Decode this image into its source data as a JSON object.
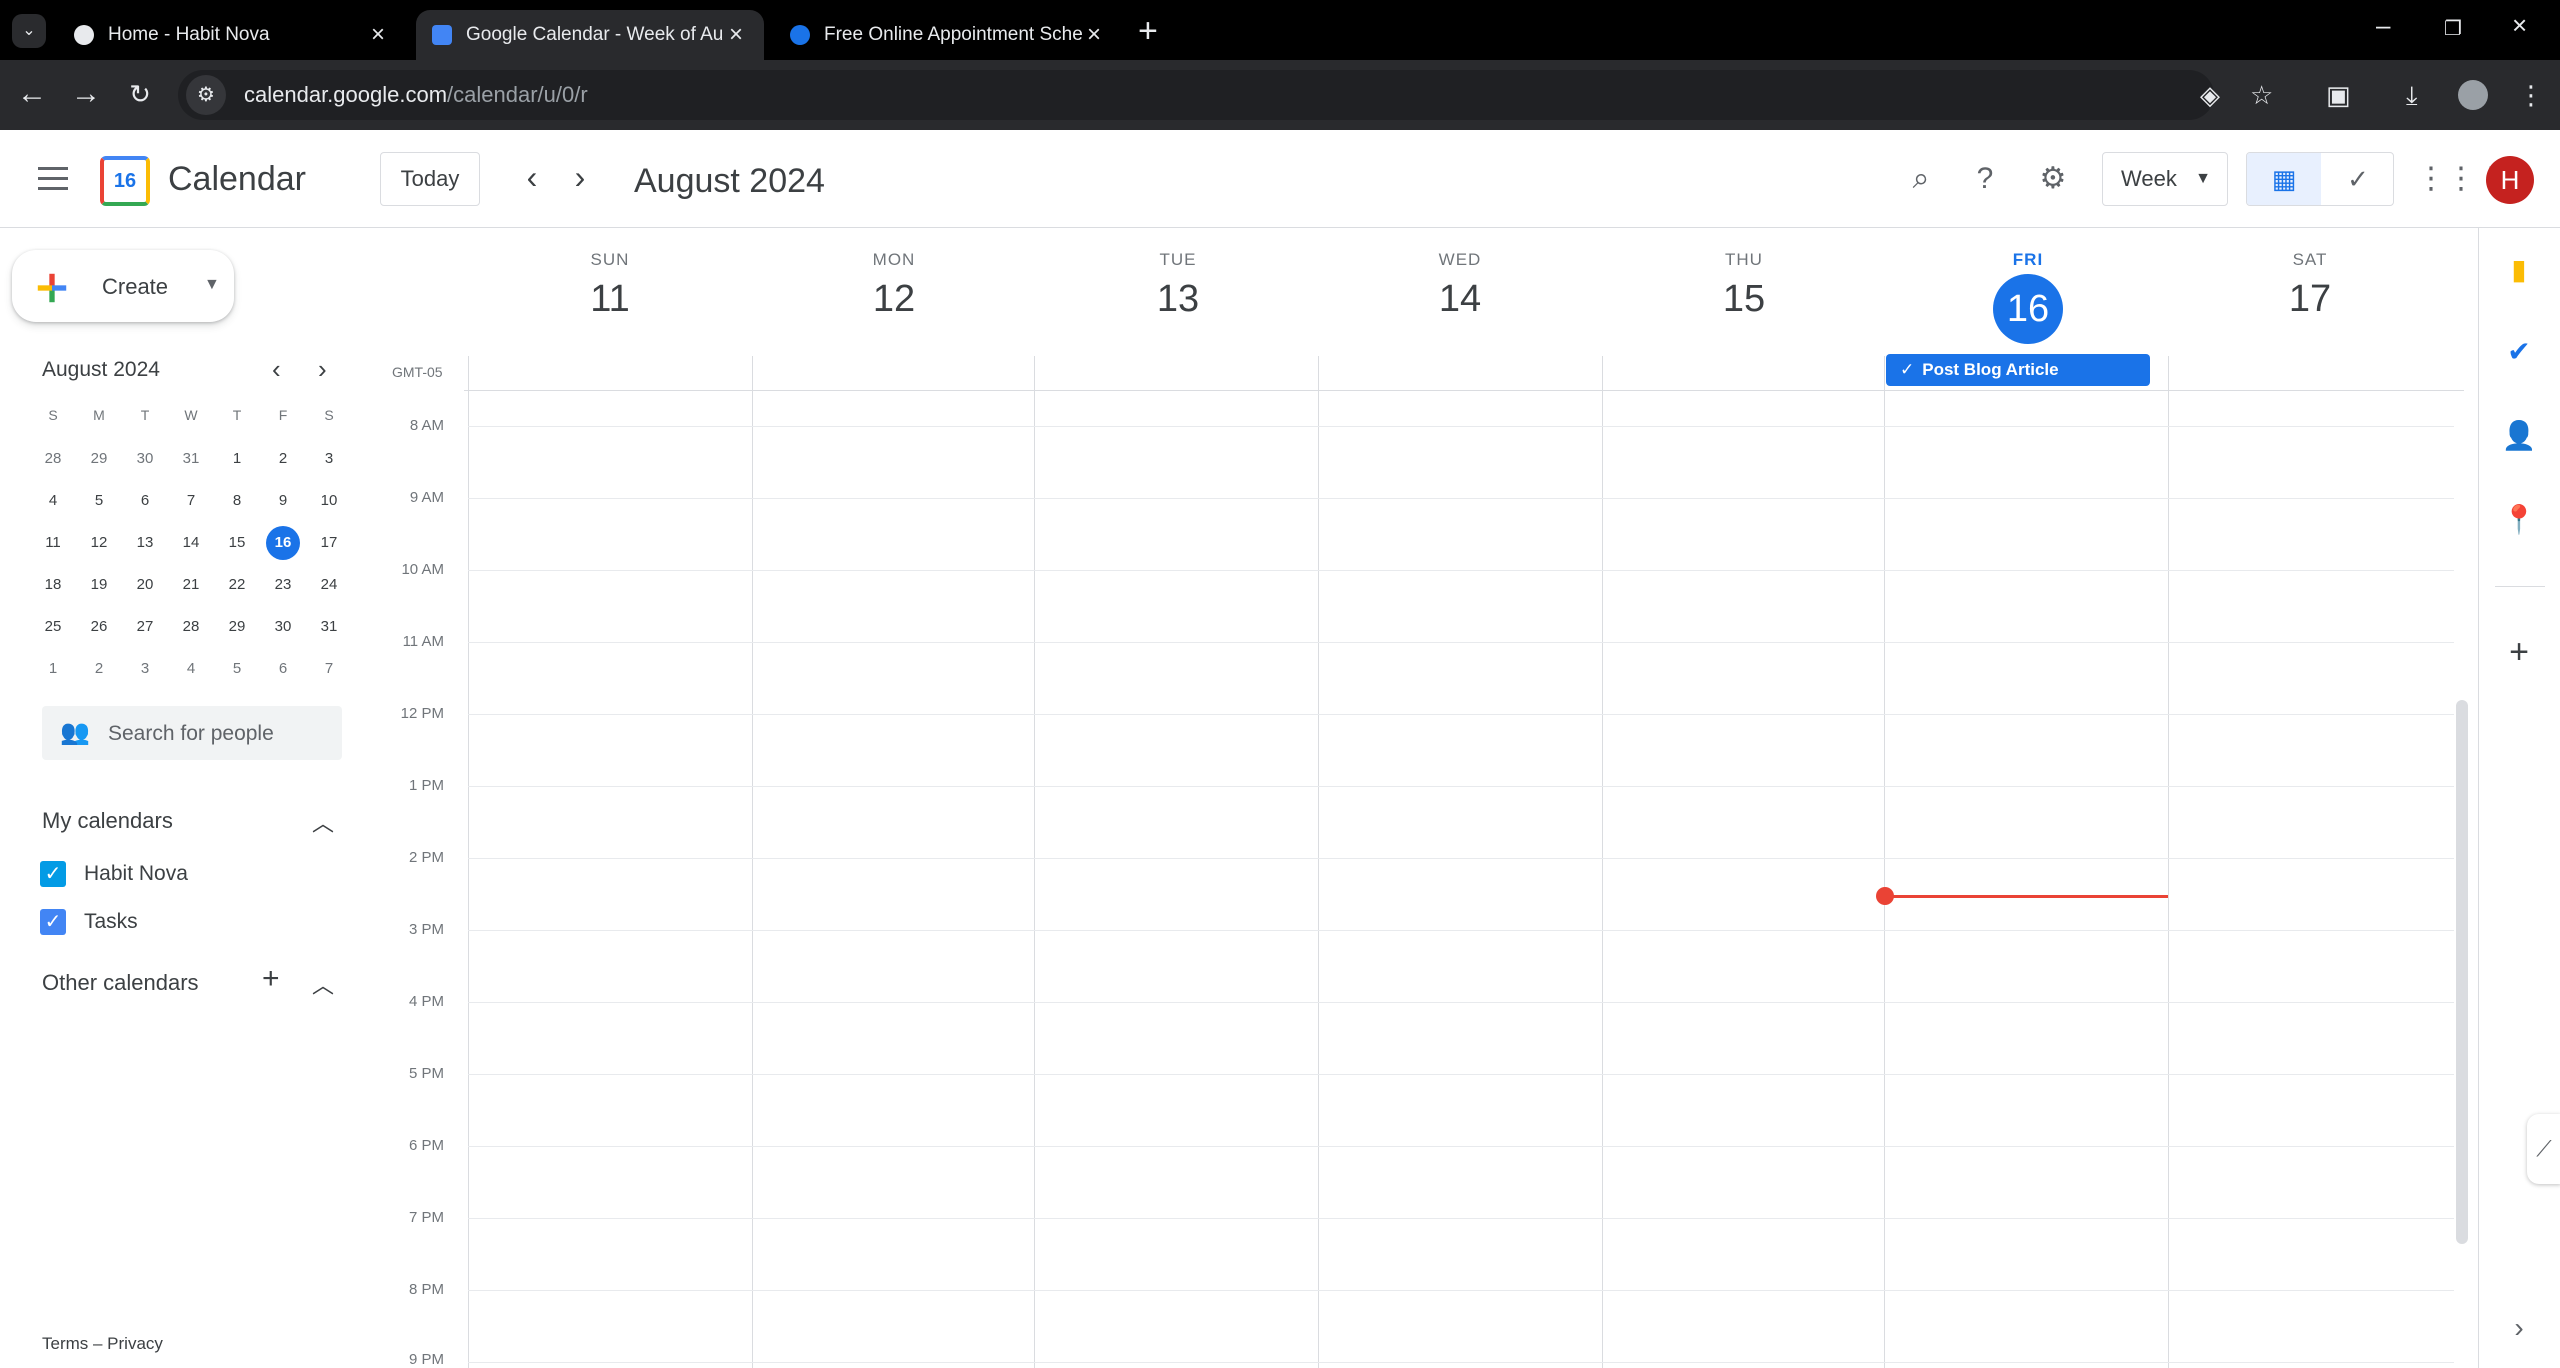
{
  "browser": {
    "tabs": [
      {
        "title": "Home - Habit Nova",
        "active": false
      },
      {
        "title": "Google Calendar - Week of Aug",
        "active": true
      },
      {
        "title": "Free Online Appointment Sche",
        "active": false
      }
    ],
    "url_host": "calendar.google.com",
    "url_path": "/calendar/u/0/r"
  },
  "header": {
    "app_title": "Calendar",
    "logo_day": "16",
    "today_label": "Today",
    "month_title": "August 2024",
    "view_label": "Week",
    "avatar_initial": "H"
  },
  "sidebar": {
    "create_label": "Create",
    "mini_month_title": "August 2024",
    "dow": [
      "S",
      "M",
      "T",
      "W",
      "T",
      "F",
      "S"
    ],
    "weeks": [
      [
        "28",
        "29",
        "30",
        "31",
        "1",
        "2",
        "3"
      ],
      [
        "4",
        "5",
        "6",
        "7",
        "8",
        "9",
        "10"
      ],
      [
        "11",
        "12",
        "13",
        "14",
        "15",
        "16",
        "17"
      ],
      [
        "18",
        "19",
        "20",
        "21",
        "22",
        "23",
        "24"
      ],
      [
        "25",
        "26",
        "27",
        "28",
        "29",
        "30",
        "31"
      ],
      [
        "1",
        "2",
        "3",
        "4",
        "5",
        "6",
        "7"
      ]
    ],
    "selected_day": "16",
    "search_people_placeholder": "Search for people",
    "my_calendars_label": "My calendars",
    "my_calendars": [
      {
        "name": "Habit Nova",
        "color": "#039be5",
        "checked": true
      },
      {
        "name": "Tasks",
        "color": "#4285f4",
        "checked": true
      }
    ],
    "other_calendars_label": "Other calendars",
    "footer": "Terms – Privacy"
  },
  "week": {
    "timezone": "GMT-05",
    "days": [
      {
        "dow": "SUN",
        "num": "11",
        "today": false
      },
      {
        "dow": "MON",
        "num": "12",
        "today": false
      },
      {
        "dow": "TUE",
        "num": "13",
        "today": false
      },
      {
        "dow": "WED",
        "num": "14",
        "today": false
      },
      {
        "dow": "THU",
        "num": "15",
        "today": false
      },
      {
        "dow": "FRI",
        "num": "16",
        "today": true
      },
      {
        "dow": "SAT",
        "num": "17",
        "today": false
      }
    ],
    "hours": [
      "8 AM",
      "9 AM",
      "10 AM",
      "11 AM",
      "12 PM",
      "1 PM",
      "2 PM",
      "3 PM",
      "4 PM",
      "5 PM",
      "6 PM",
      "7 PM",
      "8 PM",
      "9 PM"
    ],
    "event": {
      "title": "Post Blog Article",
      "day": "FRI",
      "color": "#1a73e8"
    },
    "now_indicator_color": "#ea4335"
  },
  "colors": {
    "accent": "#1a73e8",
    "now": "#ea4335",
    "avatar": "#c5221f"
  }
}
